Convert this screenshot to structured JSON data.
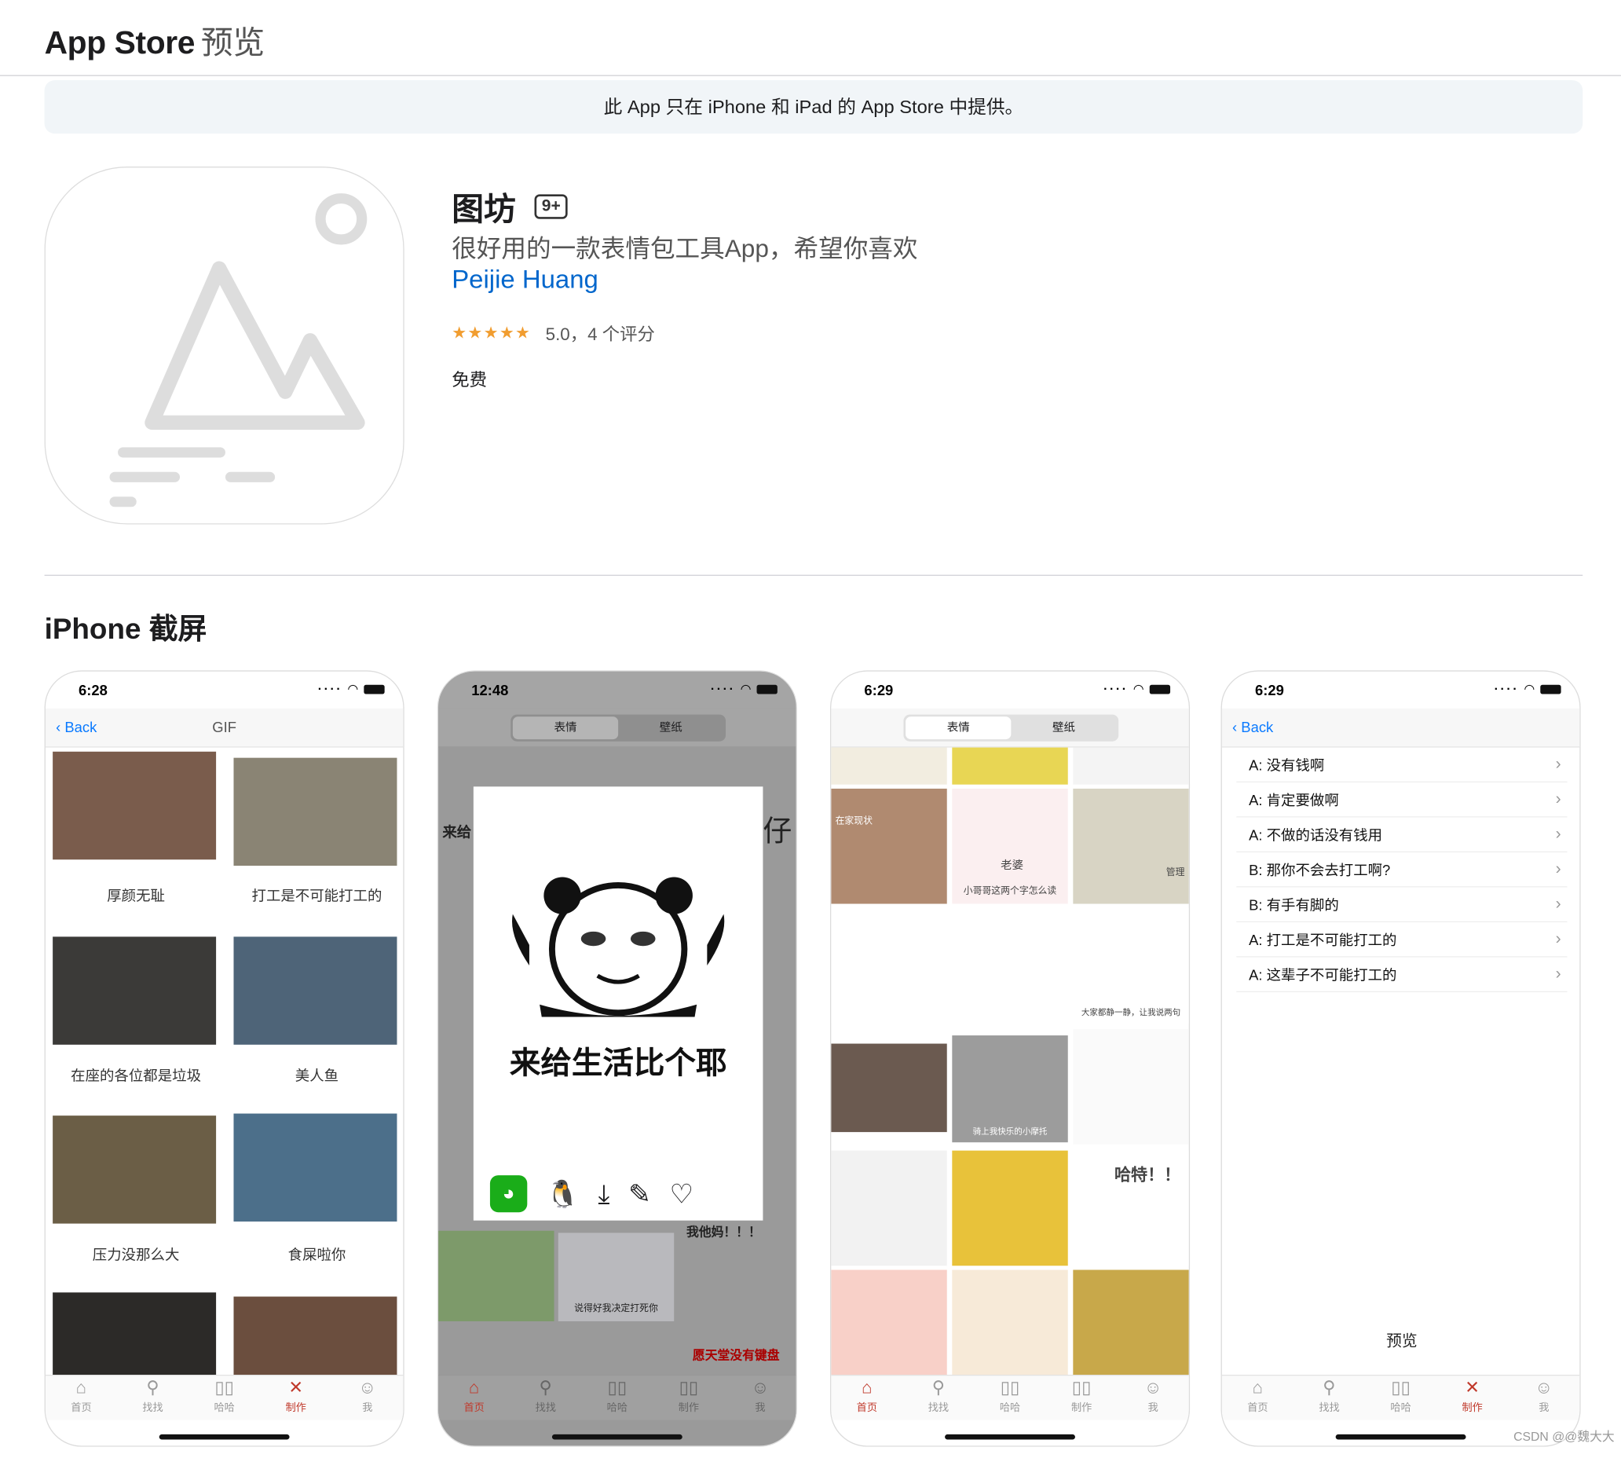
{
  "header": {
    "brand": "App Store",
    "brand_sub": "预览"
  },
  "notice": "此 App 只在 iPhone 和 iPad 的 App Store 中提供。",
  "app": {
    "name": "图坊",
    "age": "9+",
    "subtitle": "很好用的一款表情包工具App，希望你喜欢",
    "developer": "Peijie Huang",
    "stars": "★★★★★",
    "rating": "5.0，4 个评分",
    "price": "免费"
  },
  "section_title": "iPhone 截屏",
  "tabs": [
    {
      "label": "首页",
      "icon": "home-icon"
    },
    {
      "label": "找找",
      "icon": "search-icon"
    },
    {
      "label": "哈哈",
      "icon": "bars-icon"
    },
    {
      "label": "制作",
      "icon": "tools-icon"
    },
    {
      "label": "我",
      "icon": "smile-icon"
    }
  ],
  "shots": [
    {
      "time": "6:28",
      "back": "Back",
      "nav_title": "GIF",
      "captions": [
        "厚颜无耻",
        "打工是不可能打工的",
        "在座的各位都是垃圾",
        "美人鱼",
        "压力没那么大",
        "食屎啦你"
      ]
    },
    {
      "time": "12:48",
      "segments": [
        "表情",
        "壁纸"
      ],
      "modal_text": "来给生活比个耶",
      "bg_texts": [
        "来给",
        "仔",
        "我他妈！！！",
        "愿天堂没有键盘",
        "说得好我决定打死你"
      ]
    },
    {
      "time": "6:29",
      "segments": [
        "表情",
        "壁纸"
      ],
      "tile_texts": [
        "老婆",
        "小哥哥这两个字怎么读",
        "大家都静一静，让我说两句",
        "骑上我快乐的小摩托",
        "哈特！！",
        "在家现状",
        "管理"
      ]
    },
    {
      "time": "6:29",
      "back": "Back",
      "rows": [
        "A: 没有钱啊",
        "A: 肯定要做啊",
        "A: 不做的话没有钱用",
        "B: 那你不会去打工啊?",
        "B: 有手有脚的",
        "A: 打工是不可能打工的",
        "A: 这辈子不可能打工的"
      ],
      "footer": "预览"
    }
  ],
  "credit": "CSDN @@魏大大"
}
